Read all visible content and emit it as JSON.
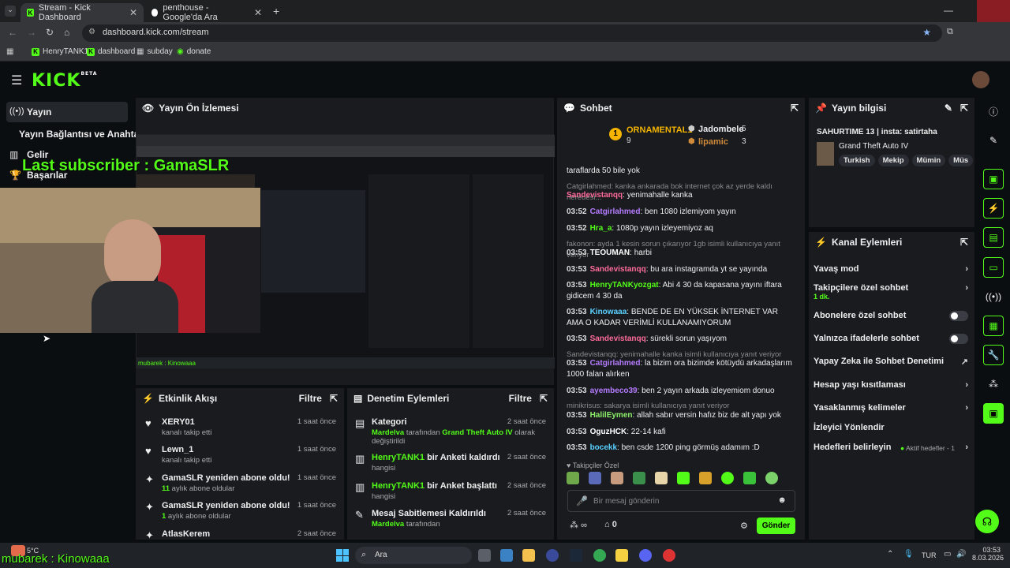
{
  "browser": {
    "tabs": [
      {
        "label": "Stream - Kick Dashboard"
      },
      {
        "label": "penthouse - Google'da Ara"
      }
    ],
    "url": "dashboard.kick.com/stream",
    "bookmarks": [
      "HenryTANK1",
      "dashboard",
      "subday",
      "donate"
    ]
  },
  "app": {
    "logo": "KICK",
    "logo_badge": "BETA"
  },
  "sidebar": {
    "items": [
      {
        "label": "Yayın",
        "icon": "broadcast-icon"
      },
      {
        "label": "Yayın Bağlantısı ve Anahtarı"
      },
      {
        "label": "Gelir",
        "icon": "chart-icon"
      },
      {
        "label": "Başarılar",
        "icon": "trophy-icon"
      }
    ]
  },
  "overlay": {
    "last_subscriber": "Last subscriber : GamaSLR",
    "ticker": "mubarek : Kinowaaa",
    "ticker_small": "mubarek : Kinowaaa"
  },
  "preview": {
    "title": "Yayın Ön İzlemesi"
  },
  "chat": {
    "title": "Sohbet",
    "leaders": [
      {
        "rank": "1",
        "name": "ORNAMENTAL1",
        "count": "9"
      },
      {
        "name": "Jadombele",
        "count": "5"
      },
      {
        "name": "lipamic",
        "count": "3"
      }
    ],
    "messages": [
      {
        "time": "",
        "user": "",
        "text": "taraflarda 50 bile yok"
      },
      {
        "sys": "Catgirlahmed: kanka ankarada bok internet çok az yerde kaldı neredesi..."
      },
      {
        "time": "",
        "user": "Sandevistanqq",
        "text": ": yenimahalle kanka"
      },
      {
        "time": "03:52",
        "user": "Catgirlahmed",
        "text": ": ben 1080 izlemiyom yayın"
      },
      {
        "time": "03:52",
        "user": "Hra_a",
        "text": ": 1080p yayın izleyemiyoz aq"
      },
      {
        "sys": "fakonon: ayda 1 kesin sorun çıkarıyor 1gb isimli kullanıcıya yanıt veriyor"
      },
      {
        "time": "03:53",
        "user": "TEOUMAN",
        "text": ": harbi"
      },
      {
        "time": "03:53",
        "user": "Sandevistanqq",
        "text": ": bu ara instagramda yt se yayında"
      },
      {
        "time": "03:53",
        "user": "HenryTANKyozgat",
        "text": ": Abi 4 30 da kapasana yayını iftara gidicem 4 30 da"
      },
      {
        "time": "03:53",
        "user": "Kinowaaa",
        "text": ": BENDE DE EN YÜKSEK İNTERNET VAR AMA O KADAR VERİMLİ KULLANAMIYORUM"
      },
      {
        "time": "03:53",
        "user": "Sandevistanqq",
        "text": ": sürekli sorun yaşıyom"
      },
      {
        "sys": "Sandevistanqq: yenimahalle kanka isimli kullanıcıya yanıt veriyor"
      },
      {
        "time": "03:53",
        "user": "Catgirlahmed",
        "text": ": la bizim ora bizimde kötüydü arkadaşlarım 1000 falan alırken"
      },
      {
        "time": "03:53",
        "user": "ayembeco39",
        "text": ": ben 2 yayın arkada izleyemiom donuo"
      },
      {
        "sys": "minikrisus: sakarya isimli kullanıcıya yanıt veriyor"
      },
      {
        "time": "03:53",
        "user": "HalilEymen",
        "text": ": allah sabır versin hafız biz de alt yapı yok"
      },
      {
        "time": "03:53",
        "user": "OguzHCK",
        "text": ": 22-14 kafi"
      },
      {
        "time": "03:53",
        "user": "bocekk",
        "text": ": ben csde 1200 ping görmüş adamım :D"
      }
    ],
    "emote_label": "Takipçiler Özel",
    "input_placeholder": "Bir mesaj gönderin",
    "viewers": "∞",
    "gifts": "0",
    "send_label": "Gönder"
  },
  "stream_info": {
    "title": "Yayın bilgisi",
    "stream_title": "SAHURTIME 13 | insta: satirtaha",
    "category": "Grand Theft Auto IV",
    "tags": [
      "Turkish",
      "Mekip",
      "Mümin",
      "Müs"
    ]
  },
  "channel_actions": {
    "title": "Kanal Eylemleri",
    "items": [
      {
        "label": "Yavaş mod"
      },
      {
        "label": "Takipçilere özel sohbet",
        "sub": "1 dk."
      },
      {
        "label": "Abonelere özel sohbet"
      },
      {
        "label": "Yalnızca ifadelerle sohbet"
      },
      {
        "label": "Yapay Zeka ile Sohbet Denetimi"
      },
      {
        "label": "Hesap yaşı kısıtlaması"
      },
      {
        "label": "Yasaklanmış kelimeler"
      },
      {
        "label": "İzleyici Yönlendir"
      },
      {
        "label": "Hedefleri belirleyin",
        "extra": "Aktif hedefler - 1"
      }
    ]
  },
  "activity": {
    "title": "Etkinlik Akışı",
    "filter": "Filtre",
    "items": [
      {
        "name": "XERY01",
        "sub": "kanalı takip etti",
        "time": "1 saat önce",
        "icon": "heart-icon"
      },
      {
        "name": "Lewn_1",
        "sub": "kanalı takip etti",
        "time": "1 saat önce",
        "icon": "heart-icon"
      },
      {
        "name": "GamaSLR yeniden abone oldu!",
        "sub_num": "11",
        "sub": " aylık abone oldular",
        "time": "1 saat önce",
        "icon": "sparkle-icon"
      },
      {
        "name": "GamaSLR yeniden abone oldu!",
        "sub_num": "1",
        "sub": " aylık abone oldular",
        "time": "1 saat önce",
        "icon": "sparkle-icon"
      },
      {
        "name": "AtlasKerem",
        "time": "2 saat önce",
        "icon": "sparkle-icon"
      }
    ]
  },
  "moderation": {
    "title": "Denetim Eylemleri",
    "filter": "Filtre",
    "items": [
      {
        "name": "Kategori",
        "actor": "Mardelva",
        "mid": " tarafından ",
        "target": "Grand Theft Auto IV",
        "after": " olarak değiştirildi",
        "time": "2 saat önce"
      },
      {
        "name_green": "HenryTANK1",
        "name": " bir Anketi kaldırdı",
        "sub": "hangisi",
        "time": "2 saat önce"
      },
      {
        "name_green": "HenryTANK1",
        "name": " bir Anket başlattı",
        "sub": "hangisi",
        "time": "2 saat önce"
      },
      {
        "name": "Mesaj Sabitlemesi Kaldırıldı",
        "actor": "Mardelva",
        "mid": " tarafından",
        "time": "2 saat önce"
      }
    ]
  },
  "taskbar": {
    "weather": "5°C",
    "search": "Ara",
    "lang": "TUR",
    "time": "03:53",
    "date": "8.03.2026"
  },
  "colors": {
    "accent": "#53fc18",
    "panel": "#191b1f",
    "bg": "#0b0e11"
  }
}
